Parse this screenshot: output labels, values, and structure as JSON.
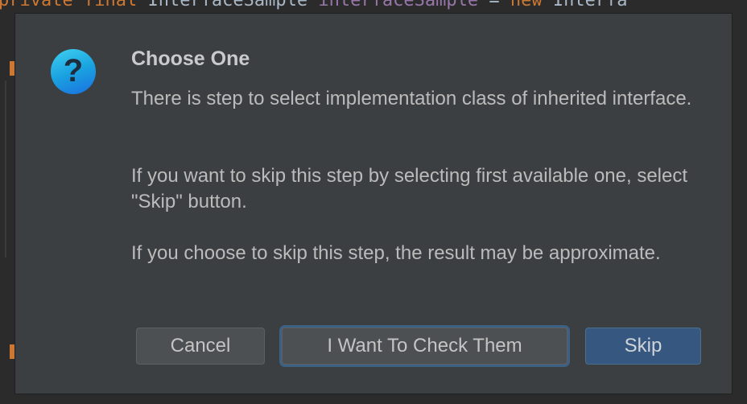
{
  "editor": {
    "code_kw_private": "private",
    "code_kw_final": "final",
    "code_type": "InterfaceSample",
    "code_field": "interfaceSample",
    "code_eq": "=",
    "code_kw_new": "new",
    "code_ctor": "Interfa"
  },
  "dialog": {
    "icon": "question-icon",
    "icon_glyph": "?",
    "title": "Choose One",
    "message_line1": "There is step to select implementation class of inherited interface.",
    "message_line2": "If you want to skip this step by selecting first available one, select \"Skip\" button.",
    "message_line3": "If you choose to skip this step, the result may be approximate.",
    "buttons": {
      "cancel": "Cancel",
      "check": "I Want To Check Them",
      "skip": "Skip"
    }
  },
  "colors": {
    "dialog_bg": "#3c3f41",
    "primary_button": "#365880",
    "focus_ring": "#3d6185",
    "icon_gradient_start": "#3fd0f0",
    "icon_gradient_end": "#1a6fe0"
  }
}
